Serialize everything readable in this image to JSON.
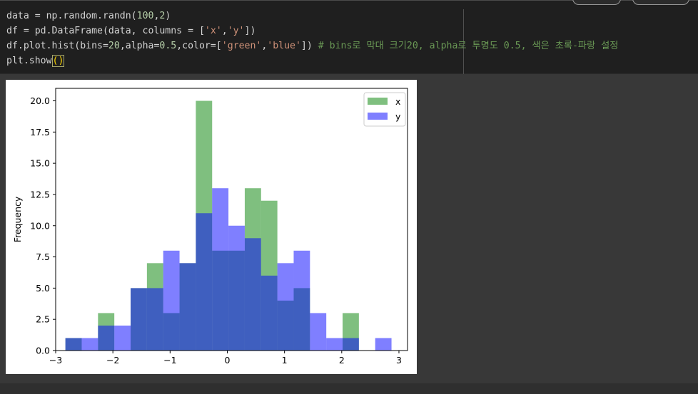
{
  "code_cell": {
    "lines": [
      [
        {
          "t": "data = np.random.randn("
        },
        {
          "t": "100",
          "k": "n"
        },
        {
          "t": ","
        },
        {
          "t": "2",
          "k": "n"
        },
        {
          "t": ")"
        }
      ],
      [
        {
          "t": "df = pd.DataFrame(data, columns = ["
        },
        {
          "t": "'x'",
          "k": "s"
        },
        {
          "t": ","
        },
        {
          "t": "'y'",
          "k": "s"
        },
        {
          "t": "])"
        }
      ],
      [
        {
          "t": "df.plot.hist(bins="
        },
        {
          "t": "20",
          "k": "n"
        },
        {
          "t": ",alpha="
        },
        {
          "t": "0.5",
          "k": "n"
        },
        {
          "t": ",color=["
        },
        {
          "t": "'green'",
          "k": "s"
        },
        {
          "t": ","
        },
        {
          "t": "'blue'",
          "k": "s"
        },
        {
          "t": "]) "
        },
        {
          "t": "# bins로 막대 크기20, alpha로 투명도 0.5, 색은 초록-파랑 설정",
          "k": "c"
        }
      ],
      [
        {
          "t": "plt.show"
        },
        {
          "t": "()",
          "k": "box"
        }
      ]
    ]
  },
  "chart_data": {
    "type": "bar",
    "subtype": "overlapping-histogram",
    "title": "",
    "xlabel": "",
    "ylabel": "Frequency",
    "xlim": [
      -3.0,
      3.15
    ],
    "ylim": [
      0,
      21
    ],
    "xticks": [
      -3,
      -2,
      -1,
      0,
      1,
      2,
      3
    ],
    "xtick_labels": [
      "−3",
      "−2",
      "−1",
      "0",
      "1",
      "2",
      "3"
    ],
    "yticks": [
      0,
      2.5,
      5,
      7.5,
      10,
      12.5,
      15,
      17.5,
      20
    ],
    "ytick_labels": [
      "0.0",
      "2.5",
      "5.0",
      "7.5",
      "10.0",
      "12.5",
      "15.0",
      "17.5",
      "20.0"
    ],
    "bin_edges": [
      -2.83,
      -2.545,
      -2.26,
      -1.975,
      -1.69,
      -1.405,
      -1.12,
      -0.835,
      -0.55,
      -0.265,
      0.02,
      0.305,
      0.59,
      0.875,
      1.16,
      1.445,
      1.73,
      2.015,
      2.3,
      2.585,
      2.87
    ],
    "alpha": 0.5,
    "legend_position": "top-right",
    "grid": false,
    "series": [
      {
        "name": "x",
        "color": "#008000",
        "values": [
          1,
          0,
          3,
          0,
          5,
          7,
          3,
          7,
          20,
          8,
          8,
          13,
          12,
          4,
          5,
          0,
          0,
          3,
          0,
          0
        ]
      },
      {
        "name": "y",
        "color": "#0000ff",
        "values": [
          1,
          1,
          2,
          2,
          5,
          5,
          8,
          7,
          11,
          13,
          10,
          9,
          6,
          7,
          8,
          3,
          1,
          1,
          0,
          1
        ]
      }
    ]
  }
}
